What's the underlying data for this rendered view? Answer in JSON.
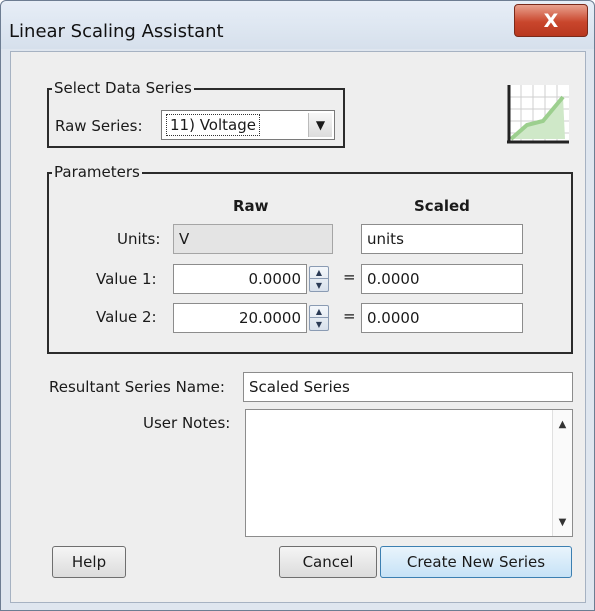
{
  "window": {
    "title": "Linear Scaling Assistant",
    "close_glyph": "X"
  },
  "select_group": {
    "legend": "Select Data Series",
    "raw_series_label": "Raw Series:",
    "raw_series_value": "11) Voltage",
    "dropdown_icon": "chevron-down-icon"
  },
  "parameters": {
    "legend": "Parameters",
    "col_raw": "Raw",
    "col_scaled": "Scaled",
    "units_label": "Units:",
    "raw_units": "V",
    "scaled_units": "units",
    "value1_label": "Value 1:",
    "value1_raw": "0.0000",
    "value1_scaled": "0.0000",
    "value2_label": "Value 2:",
    "value2_raw": "20.0000",
    "value2_scaled": "0.0000",
    "equals": "="
  },
  "result": {
    "name_label": "Resultant Series Name:",
    "name_value": "Scaled Series",
    "notes_label": "User Notes:",
    "notes_value": ""
  },
  "buttons": {
    "help": "Help",
    "cancel": "Cancel",
    "create": "Create New Series"
  },
  "colors": {
    "title_bar": "#dbe4ef",
    "close_button": "#c9462c",
    "primary_button": "#c6e2f6"
  }
}
